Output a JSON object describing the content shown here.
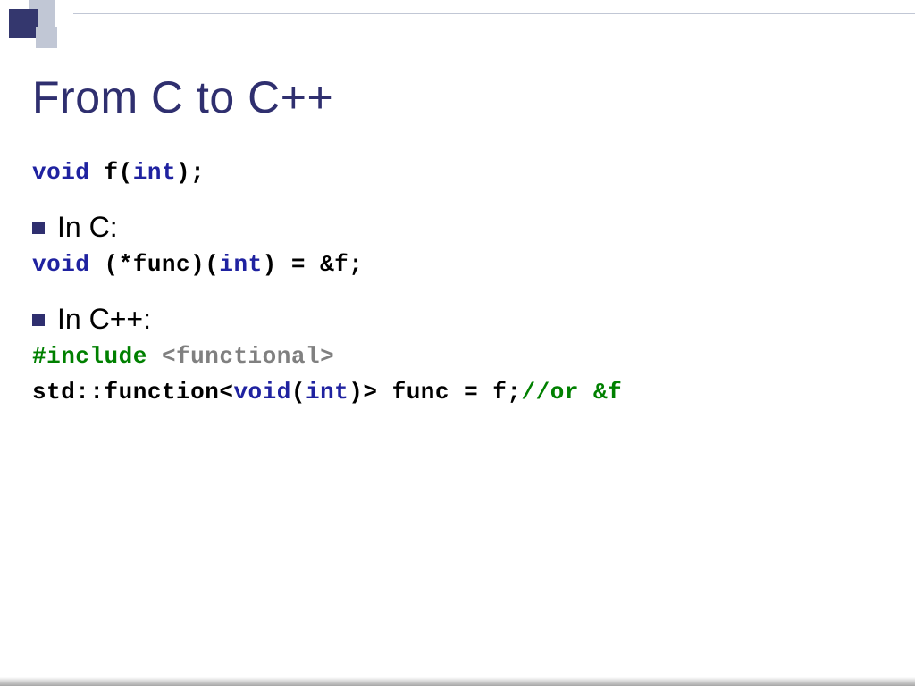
{
  "title": "From C to C++",
  "line1": {
    "void": "void",
    "rest": " f(",
    "int": "int",
    "end": ");"
  },
  "bullet1": "In C:",
  "line2": {
    "void": "void",
    "rest1": " (*func)(",
    "int": "int",
    "rest2": ") = &f;"
  },
  "bullet2": "In C++:",
  "line3": {
    "include": "#include",
    "space": " ",
    "hdr": "<functional>"
  },
  "line4": {
    "a": "std::function<",
    "void": "void",
    "b": "(",
    "int": "int",
    "c": ")> func = f;",
    "comment": "//or &f"
  }
}
